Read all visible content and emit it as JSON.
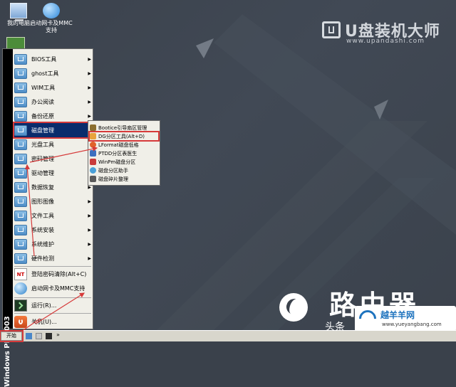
{
  "desktop": {
    "icons": [
      {
        "name": "my-computer",
        "label": "我的电脑"
      },
      {
        "name": "network-mmc",
        "label": "启动网卡及MMC支持"
      }
    ],
    "brand": {
      "title": "U盘装机大师",
      "url": "www.upandashi.com"
    }
  },
  "start_menu": {
    "side_label": "Windows PE 2003",
    "items": [
      {
        "label": "BIOS工具",
        "has_submenu": true
      },
      {
        "label": "ghost工具",
        "has_submenu": true
      },
      {
        "label": "WIM工具",
        "has_submenu": true
      },
      {
        "label": "办公阅读",
        "has_submenu": true
      },
      {
        "label": "备份还原",
        "has_submenu": true
      },
      {
        "label": "磁盘管理",
        "has_submenu": true,
        "active": true
      },
      {
        "label": "光盘工具",
        "has_submenu": true
      },
      {
        "label": "密码管理",
        "has_submenu": true
      },
      {
        "label": "驱动管理",
        "has_submenu": true
      },
      {
        "label": "数据恢复",
        "has_submenu": true
      },
      {
        "label": "图形图像",
        "has_submenu": true
      },
      {
        "label": "文件工具",
        "has_submenu": true
      },
      {
        "label": "系统安装",
        "has_submenu": true
      },
      {
        "label": "系统维护",
        "has_submenu": true
      },
      {
        "label": "硬件检测",
        "has_submenu": true
      }
    ],
    "extra_items": [
      {
        "label": "登陆密码清除(Alt+C)"
      },
      {
        "label": "启动网卡及MMC支持"
      }
    ],
    "run_label": "运行(R)...",
    "shutdown_label": "关机(U)..."
  },
  "submenu": {
    "items": [
      {
        "label": "Bootice引导扇区管理",
        "color": "#8a6e2f"
      },
      {
        "label": "DG分区工具(Alt+D)",
        "color": "#e8a33c",
        "highlight": true
      },
      {
        "label": "LFormat磁盘低格",
        "color": "#e0612a"
      },
      {
        "label": "PTDD分区表医生",
        "color": "#3c6fc0"
      },
      {
        "label": "WinPm磁盘分区",
        "color": "#c93b3b"
      },
      {
        "label": "磁盘分区助手",
        "color": "#4aa0d8"
      },
      {
        "label": "磁盘碎片整理",
        "color": "#5a5a5a"
      }
    ]
  },
  "taskbar": {
    "start_label": "开始",
    "more": "»"
  },
  "watermark": {
    "toutiao": "头条",
    "big_text": "路由器",
    "badge_title": "越羊羊网",
    "badge_url": "www.yueyangbang.com"
  },
  "colors": {
    "desktop_bg": "#3b424c",
    "menu_bg": "#f0efe8",
    "active_bg": "#0a2c6c",
    "annotation": "#d63a3a"
  }
}
